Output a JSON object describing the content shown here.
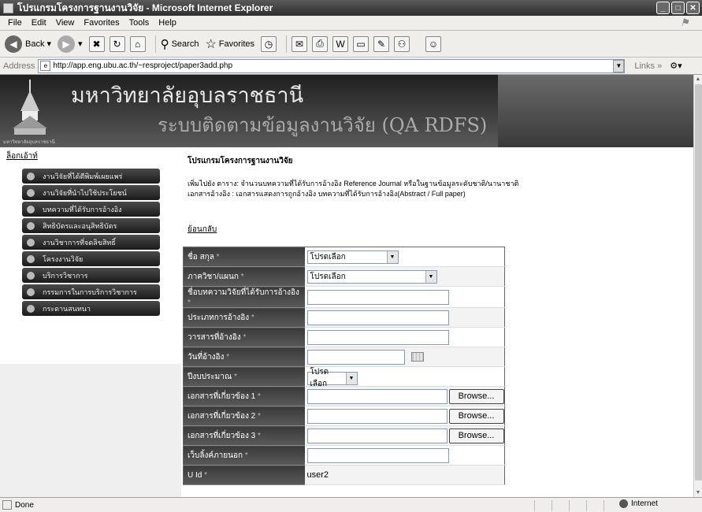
{
  "window": {
    "title": "โปรแกรมโครงการฐานงานวิจัย - Microsoft Internet Explorer"
  },
  "menu": [
    "File",
    "Edit",
    "View",
    "Favorites",
    "Tools",
    "Help"
  ],
  "toolbar": {
    "back": "Back",
    "search": "Search",
    "favorites": "Favorites"
  },
  "address": {
    "label": "Address",
    "url": "http://app.eng.ubu.ac.th/~resproject/paper3add.php",
    "links": "Links"
  },
  "banner": {
    "university": "มหาวิทยาลัยอุบลราชธานี",
    "system": "ระบบติดตามข้อมูลงานวิจัย (QA RDFS)"
  },
  "sidebar": {
    "logout": "ล็อกเอ้าท์",
    "items": [
      {
        "label": "งานวิจัยที่ได้ตีพิมพ์เผยแพร่"
      },
      {
        "label": "งานวิจัยที่นำไปใช้ประโยชน์"
      },
      {
        "label": "บทความที่ได้รับการอ้างอิง"
      },
      {
        "label": "สิทธิบัตรและอนุสิทธิบัตร"
      },
      {
        "label": "งานวิชาการที่จดลิขสิทธิ์"
      },
      {
        "label": "โครงงานวิจัย"
      },
      {
        "label": "บริการวิชาการ"
      },
      {
        "label": "กรรมการในการบริการวิชาการ"
      },
      {
        "label": "กระดานสนทนา"
      }
    ]
  },
  "main": {
    "title": "โปรแกรมโครงการฐานงานวิจัย",
    "desc1": "เพิ่มไปยัง ตาราง: จำนวนบทความที่ได้รับการอ้างอิง Reference Journal หรือในฐานข้อมูลระดับชาติ/นานาชาติ",
    "desc2": "เอกสารอ้างอิง : เอกสารแสดงการถูกอ้างอิง บทความที่ได้รับการอ้างอิง(Abstract / Full paper)",
    "back": "ย้อนกลับ"
  },
  "form": {
    "required_mark": "*",
    "select_placeholder": "โปรดเลือก",
    "browse": "Browse...",
    "rows": [
      {
        "label": "ชื่อ สกุล"
      },
      {
        "label": "ภาควิชา/แผนก"
      },
      {
        "label": "ชื่อบทความวิจัยที่ได้รับการอ้างอิง"
      },
      {
        "label": "ประเภทการอ้างอิง"
      },
      {
        "label": "วารสารที่อ้างอิง"
      },
      {
        "label": "วันที่อ้างอิง"
      },
      {
        "label": "ปีงบประมาณ"
      },
      {
        "label": "เอกสารที่เกี่ยวข้อง 1"
      },
      {
        "label": "เอกสารที่เกี่ยวข้อง 2"
      },
      {
        "label": "เอกสารที่เกี่ยวข้อง 3"
      },
      {
        "label": "เว็บลิ้งค์ภายนอก"
      },
      {
        "label": "U Id",
        "value": "user2"
      }
    ]
  },
  "status": {
    "text": "Done",
    "zone": "Internet"
  }
}
